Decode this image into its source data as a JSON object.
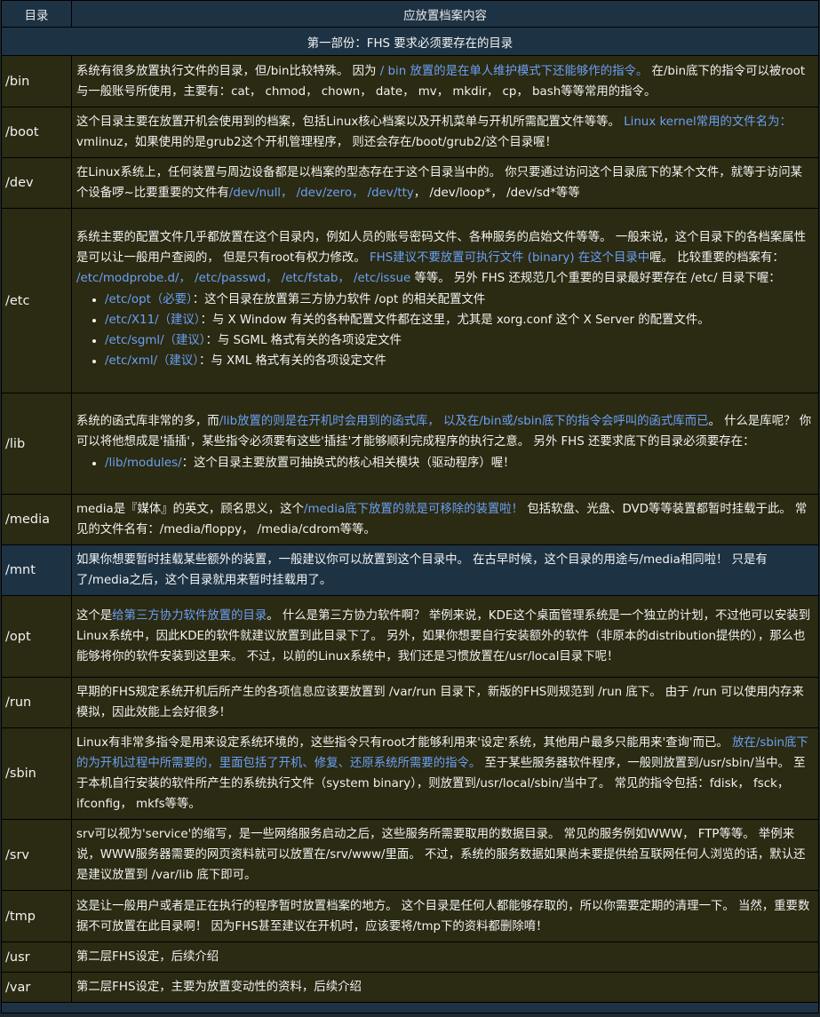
{
  "header": {
    "col1": "目录",
    "col2": "应放置档案内容"
  },
  "section_title": "第一部份：FHS 要求必须要存在的目录",
  "rows": [
    {
      "dir": "/bin",
      "segments": [
        {
          "t": "系统有很多放置执行文件的目录，但/bin比较特殊。 因为 "
        },
        {
          "t": "/ bin 放置的是在单人维护模式下还能够作的指令。",
          "h": true
        },
        {
          "t": " 在/bin底下的指令可以被root与一般账号所使用，主要有：cat， chmod， chown， date， mv， mkdir， cp， bash等等常用的指令。"
        }
      ]
    },
    {
      "dir": "/boot",
      "segments": [
        {
          "t": "这个目录主要在放置开机会使用到的档案，包括Linux核心档案以及开机菜单与开机所需配置文件等等。 "
        },
        {
          "t": "Linux kernel常用的文件名为：",
          "h": true
        },
        {
          "t": "vmlinuz，如果使用的是grub2这个开机管理程序， 则还会存在/boot/grub2/这个目录喔！"
        }
      ]
    },
    {
      "dir": "/dev",
      "segments": [
        {
          "t": "在Linux系统上，任何装置与周边设备都是以档案的型态存在于这个目录当中的。 你只要通过访问这个目录底下的某个文件，就等于访问某个设备啰~比要重要的文件有"
        },
        {
          "t": "/dev/null， /dev/zero， /dev/tty",
          "h": true
        },
        {
          "t": "， /dev/loop*， /dev/sd*等等"
        }
      ]
    },
    {
      "dir": "/etc",
      "segments": [
        {
          "t": "系统主要的配置文件几乎都放置在这个目录内，例如人员的账号密码文件、各种服务的启始文件等等。 一般来说，这个目录下的各档案属性是可以让一般用户查阅的， 但是只有root有权力修改。 "
        },
        {
          "t": "FHS建议不要放置可执行文件 (binary) 在这个目录中",
          "h": true
        },
        {
          "t": "喔。 比较重要的档案有： "
        },
        {
          "t": "/etc/modprobe.d/， /etc/passwd， /etc/fstab， /etc/issue",
          "h": true
        },
        {
          "t": " 等等。 另外 FHS 还规范几个重要的目录最好要存在 /etc/ 目录下喔："
        }
      ],
      "items": [
        [
          {
            "t": "/etc/opt（必要）",
            "h": true
          },
          {
            "t": "：这个目录在放置第三方协力软件 /opt 的相关配置文件"
          }
        ],
        [
          {
            "t": "/etc/X11/（建议）",
            "h": true
          },
          {
            "t": "：与 X Window 有关的各种配置文件都在这里，尤其是 xorg.conf 这个 X Server 的配置文件。"
          }
        ],
        [
          {
            "t": "/etc/sgml/（建议）",
            "h": true
          },
          {
            "t": "：与 SGML 格式有关的各项设定文件"
          }
        ],
        [
          {
            "t": "/etc/xml/（建议）",
            "h": true
          },
          {
            "t": "：与 XML 格式有关的各项设定文件"
          }
        ]
      ]
    },
    {
      "dir": "/lib",
      "segments": [
        {
          "t": "系统的函式库非常的多，而"
        },
        {
          "t": "/lib放置的则是在开机时会用到的函式库， 以及在/bin或/sbin底下的指令会呼叫的函式库而已",
          "h": true
        },
        {
          "t": "。 什么是库呢？ 你可以将他想成是'插插'，某些指令必须要有这些'插挂'才能够顺利完成程序的执行之意。 另外 FHS 还要求底下的目录必须要存在："
        }
      ],
      "items": [
        [
          {
            "t": "/lib/modules/",
            "h": true
          },
          {
            "t": "：这个目录主要放置可抽换式的核心相关模块（驱动程序）喔！"
          }
        ]
      ]
    },
    {
      "dir": "/media",
      "segments": [
        {
          "t": "media是『媒体』的英文，顾名思义，这个"
        },
        {
          "t": "/media底下放置的就是可移除的装置啦！",
          "h": true
        },
        {
          "t": " 包括软盘、光盘、DVD等等装置都暂时挂载于此。 常见的文件名有：/media/floppy， /media/cdrom等等。"
        }
      ]
    },
    {
      "dir": "/mnt",
      "hl": true,
      "segments": [
        {
          "t": "如果你想要暂时挂载某些额外的装置，一般建议你可以放置到这个目录中。 在古早时候，这个目录的用途与/media相同啦！ 只是有了/media之后，这个目录就用来暂时挂载用了。"
        }
      ]
    },
    {
      "dir": "/opt",
      "segments": [
        {
          "t": "这个是"
        },
        {
          "t": "给第三方协力软件放置的目录",
          "h": true
        },
        {
          "t": "。 什么是第三方协力软件啊？ 举例来说，KDE这个桌面管理系统是一个独立的计划，不过他可以安装到Linux系统中，因此KDE的软件就建议放置到此目录下了。 另外，如果你想要自行安装额外的软件（非原本的distribution提供的），那么也能够将你的软件安装到这里来。 不过，以前的Linux系统中，我们还是习惯放置在/usr/local目录下呢！"
        }
      ]
    },
    {
      "dir": "/run",
      "segments": [
        {
          "t": "早期的FHS规定系统开机后所产生的各项信息应该要放置到 /var/run 目录下，新版的FHS则规范到 /run 底下。 由于 /run 可以使用内存来模拟，因此效能上会好很多！"
        }
      ]
    },
    {
      "dir": "/sbin",
      "segments": [
        {
          "t": "Linux有非常多指令是用来设定系统环境的，这些指令只有root才能够利用来'设定'系统，其他用户最多只能用来'查询'而已。 "
        },
        {
          "t": "放在/sbin底下的为开机过程中所需要的，里面包括了开机、修复、还原系统所需要的指令。",
          "h": true
        },
        {
          "t": " 至于某些服务器软件程序，一般则放置到/usr/sbin/当中。 至于本机自行安装的软件所产生的系统执行文件（system binary），则放置到/usr/local/sbin/当中了。 常见的指令包括：fdisk， fsck， ifconfig， mkfs等等。"
        }
      ]
    },
    {
      "dir": "/srv",
      "segments": [
        {
          "t": "srv可以视为'service'的缩写，是一些网络服务启动之后，这些服务所需要取用的数据目录。 常见的服务例如WWW， FTP等等。 举例来说，WWW服务器需要的网页资料就可以放置在/srv/www/里面。 不过，系统的服务数据如果尚未要提供给互联网任何人浏览的话，默认还是建议放置到 /var/lib 底下即可。"
        }
      ]
    },
    {
      "dir": "/tmp",
      "segments": [
        {
          "t": "这是让一般用户或者是正在执行的程序暂时放置档案的地方。 这个目录是任何人都能够存取的，所以你需要定期的清理一下。 当然，重要数据不可放置在此目录啊！ 因为FHS甚至建议在开机时，应该要将/tmp下的资料都删除唷！"
        }
      ]
    },
    {
      "dir": "/usr",
      "segments": [
        {
          "t": "第二层FHS设定，后续介绍"
        }
      ]
    },
    {
      "dir": "/var",
      "segments": [
        {
          "t": "第二层FHS设定，主要为放置变动性的资料，后续介绍"
        }
      ]
    }
  ]
}
